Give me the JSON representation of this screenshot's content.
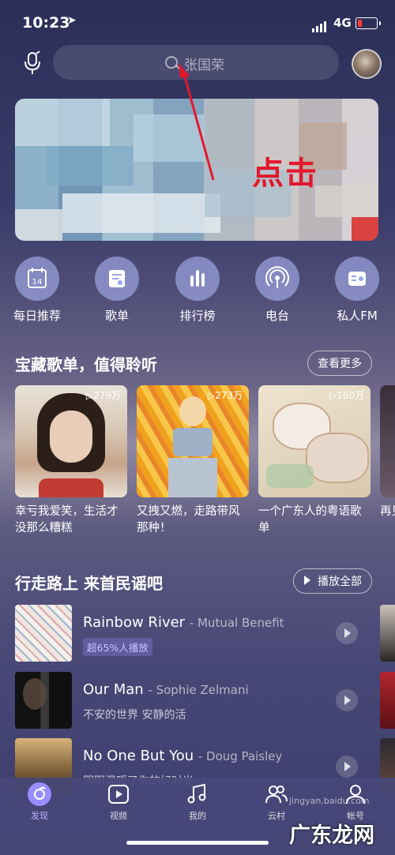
{
  "status_bar": {
    "time": "10:23",
    "network": "4G"
  },
  "header": {
    "search_placeholder": "张国荣"
  },
  "banner": {
    "annotation": "点击"
  },
  "quick_nav": [
    {
      "label": "每日推荐",
      "icon": "calendar-icon",
      "num": "14"
    },
    {
      "label": "歌单",
      "icon": "playlist-icon"
    },
    {
      "label": "排行榜",
      "icon": "chart-bars-icon"
    },
    {
      "label": "电台",
      "icon": "radio-icon"
    },
    {
      "label": "私人FM",
      "icon": "fm-icon"
    }
  ],
  "section1": {
    "title": "宝藏歌单，值得聆听",
    "more_label": "查看更多",
    "cards": [
      {
        "count": "▷279万",
        "title": "幸亏我爱笑，生活才没那么糟糕"
      },
      {
        "count": "▷273万",
        "title": "又拽又燃，走路带风那种！"
      },
      {
        "count": "▷160万",
        "title": "一个广东人的粤语歌单"
      },
      {
        "title": "再见"
      }
    ]
  },
  "section2": {
    "title": "行走路上 来首民谣吧",
    "play_all_label": "播放全部",
    "songs": [
      {
        "title": "Rainbow River",
        "artist": "- Mutual Benefit",
        "badge": "超65%人播放",
        "subtitle": ""
      },
      {
        "title": "Our Man",
        "artist": "- Sophie Zelmani",
        "badge": "",
        "subtitle": "不安的世界 安静的活"
      },
      {
        "title": "No One But You",
        "artist": "- Doug Paisley",
        "badge": "",
        "subtitle": "明明温暖了你的好时光"
      }
    ]
  },
  "tab_bar": [
    {
      "label": "发现",
      "icon": "discover-icon",
      "active": true
    },
    {
      "label": "视频",
      "icon": "video-icon",
      "active": false
    },
    {
      "label": "我的",
      "icon": "music-note-icon",
      "active": false
    },
    {
      "label": "云村",
      "icon": "community-icon",
      "active": false
    },
    {
      "label": "帐号",
      "icon": "account-icon",
      "active": false
    }
  ],
  "watermark": {
    "text": "广东龙网",
    "small": "jingyan.baidu.com"
  },
  "colors": {
    "accent_red": "#e3182c",
    "tab_active": "#9b8cff"
  }
}
